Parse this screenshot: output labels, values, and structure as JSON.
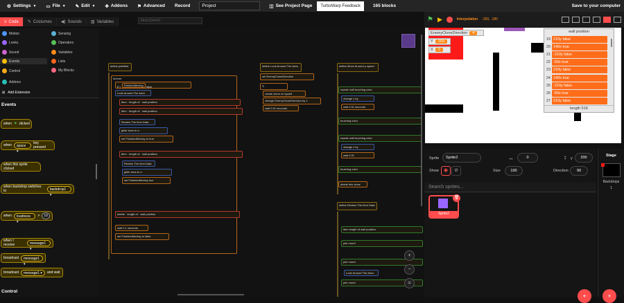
{
  "menu": {
    "settings": "Settings",
    "file": "File",
    "edit": "Edit",
    "addons": "Addons",
    "advanced": "Advanced",
    "record": "Record",
    "project_title": "Project",
    "see_project": "See Project Page",
    "feedback": "TurboWarp Feedback",
    "blocks_count": "165 blocks",
    "save": "Save to your computer"
  },
  "tabs": {
    "code": "Code",
    "costumes": "Costumes",
    "sounds": "Sounds",
    "variables": "Variables"
  },
  "find_placeholder": "Find (Ctrl+F)",
  "categories": [
    "Motion",
    "Looks",
    "Sound",
    "Events",
    "Control",
    "Addons",
    "Sensing",
    "Operators",
    "Variables",
    "Lists",
    "My Blocks"
  ],
  "add_extension": "Add Extension",
  "palette": {
    "events_heading": "Events",
    "when_flag": "when",
    "when_flag_tail": "clicked",
    "when_key": "when",
    "key_value": "space",
    "key_tail": "key pressed",
    "when_sprite": "when this sprite clicked",
    "when_backdrop": "when backdrop switches to",
    "backdrop_value": "backdrop1",
    "when_loudness": "when",
    "loudness_value": "loudness",
    "loudness_num": "10",
    "when_receive": "when I receive",
    "message_value": "message1",
    "broadcast": "broadcast",
    "broadcast_wait": "and wait",
    "control_heading": "Control"
  },
  "stage_header": {
    "interpolation": "Interpolation",
    "coords": "-300, -180"
  },
  "monitors": {
    "clone_dir_label": "EnemyCloneDirection",
    "clone_dir_value": "4",
    "y_label": "Y",
    "y_value": "200",
    "x_label": "X",
    "x_value": "0"
  },
  "list_monitor": {
    "title": "wall position",
    "indices": [
      "19",
      "20",
      "21",
      "22",
      "23",
      "24",
      "25",
      "26",
      "27"
    ],
    "items": [
      "210y false",
      "140x true",
      "-210y false",
      "-50x true",
      "210y false",
      "140x true",
      "-210y false",
      "-50x true",
      "210y false"
    ],
    "length_label": "length 518"
  },
  "sprite_info": {
    "sprite_label": "Sprite",
    "sprite_name": "Sprite2",
    "x_value": "0",
    "y_value": "200",
    "show_label": "Show",
    "size_label": "Size",
    "size_value": "100",
    "direction_label": "Direction",
    "direction_value": "90"
  },
  "sprite_search_placeholder": "Search sprites...",
  "sprite_card_name": "Sprite2",
  "stage_pane": {
    "title": "Stage",
    "backdrops_label": "Backdrops",
    "backdrops_count": "1"
  },
  "scripts": {
    "s1_hat": "define",
    "s1_name": "pathfind",
    "s1_a": "forever",
    "s1_b": "if <",
    "s1_c": "FinishedMoving",
    "s1_d": "false",
    "s1_e": "Look Around The Area",
    "s1_f": "item",
    "s1_g": "length of",
    "s1_h": "wall position",
    "s1_i": "Review The Item Data",
    "s1_j": "glide",
    "s1_k": "secs to x:",
    "s1_l": "FinishedMoving",
    "s1_m": "true",
    "s1_n": "Review The Item Data",
    "s1_o": "delete",
    "s1_p": "wait",
    "s1_q": "0.1",
    "s1_r": "seconds",
    "s1_s": "set",
    "s1_t": "to",
    "s2_hat": "define",
    "s2_name": "Look Around The Area",
    "s2_a": "EnemyCloneDirection",
    "s2_b": "create clone of",
    "s2_c": "myself",
    "s2_d": "change",
    "s2_e": "by",
    "s2_f": "1",
    "s2_g": "wait",
    "s2_h": "0.01",
    "s2_i": "seconds",
    "s3_hat": "define",
    "s3_name": "Move Around",
    "s3_a": "x",
    "s3_b": "y",
    "s3_c": "speed",
    "s3_d": "repeat until",
    "s3_e": "touching color",
    "s3_f": "change x by",
    "s3_g": "wait",
    "s3_h": "0.01",
    "s3_i": "seconds",
    "s3_j": "delete this clone",
    "s4_hat": "define",
    "s4_name": "Review The Item Data",
    "s4_a": "item",
    "s4_b": "length of",
    "s4_c": "wall position",
    "s4_d": "Look Around The Area",
    "s4_e": "round",
    "s4_f": "join"
  }
}
